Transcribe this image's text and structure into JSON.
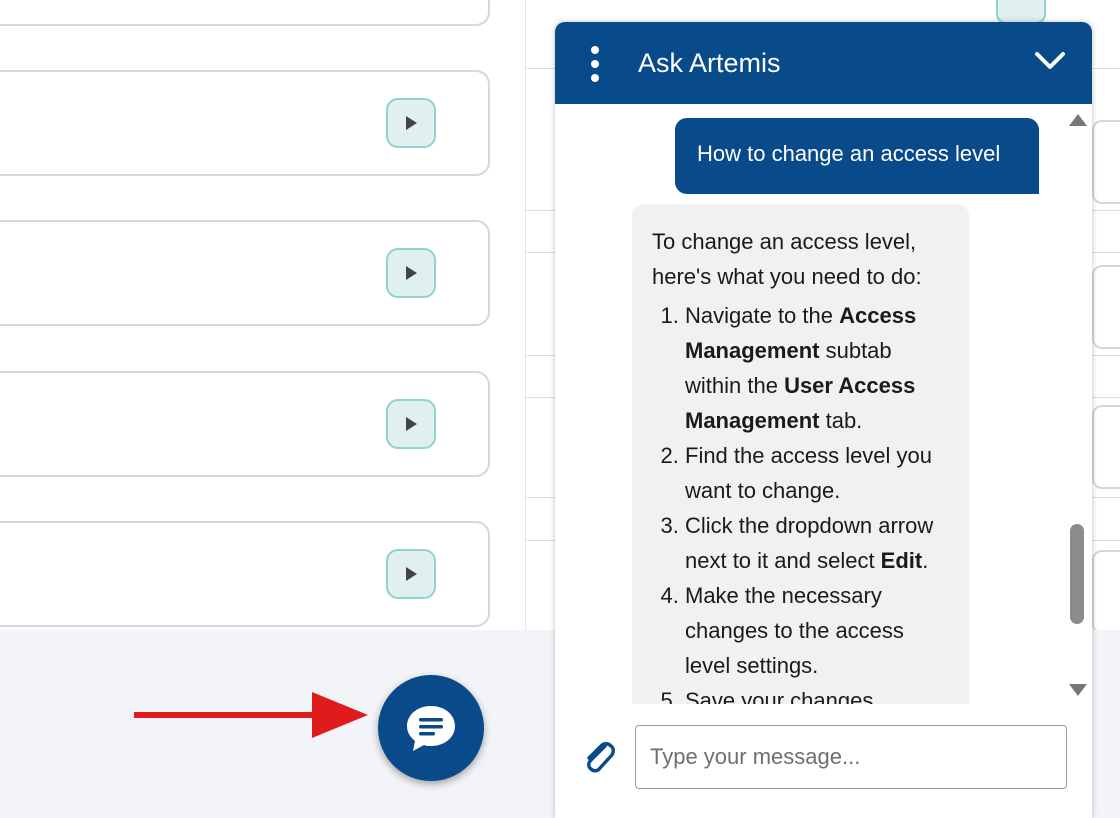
{
  "chat": {
    "title": "Ask Artemis",
    "user_message": "How to change an access level",
    "bot_reply": {
      "intro": "To change an access level, here's what you need to do:",
      "steps": [
        {
          "parts": [
            {
              "text": "Navigate to the ",
              "bold": false
            },
            {
              "text": "Access Management",
              "bold": true
            },
            {
              "text": " subtab within the ",
              "bold": false
            },
            {
              "text": "User Access Management",
              "bold": true
            },
            {
              "text": " tab.",
              "bold": false
            }
          ]
        },
        {
          "parts": [
            {
              "text": "Find the access level you want to change.",
              "bold": false
            }
          ]
        },
        {
          "parts": [
            {
              "text": "Click the dropdown arrow next to it and select ",
              "bold": false
            },
            {
              "text": "Edit",
              "bold": true
            },
            {
              "text": ".",
              "bold": false
            }
          ]
        },
        {
          "parts": [
            {
              "text": "Make the necessary changes to the access level settings.",
              "bold": false
            }
          ]
        },
        {
          "parts": [
            {
              "text": "Save your changes.",
              "bold": false
            }
          ]
        }
      ]
    },
    "input": {
      "placeholder": "Type your message...",
      "value": ""
    }
  },
  "icons": {
    "menu": "kebab-menu-icon",
    "collapse": "chevron-down-icon",
    "attach": "paperclip-icon",
    "launcher": "chat-bubble-icon",
    "play": "play-icon",
    "annotation": "red-arrow-icon"
  },
  "colors": {
    "brand": "#084a8a",
    "annotation_arrow": "#e01b1b",
    "play_button_fill": "#dff0ef",
    "play_button_border": "#8fd3cc",
    "bot_bubble": "#f1f1f2",
    "page_footer": "#f3f4f8"
  }
}
